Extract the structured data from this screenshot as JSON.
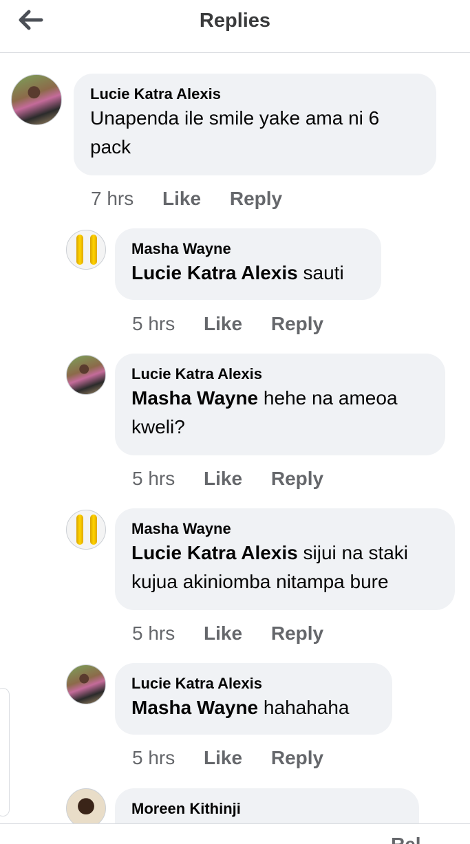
{
  "header": {
    "title": "Replies",
    "back_icon": "arrow-left-icon"
  },
  "comments": [
    {
      "author": "Lucie Katra Alexis",
      "mention": "",
      "text": "Unapenda ile smile yake ama ni 6",
      "text2": "pack",
      "time": "7 hrs",
      "like": "Like",
      "reply": "Reply"
    },
    {
      "author": "Masha Wayne",
      "mention": "Lucie Katra Alexis",
      "text": " sauti",
      "time": "5 hrs",
      "like": "Like",
      "reply": "Reply"
    },
    {
      "author": "Lucie Katra Alexis",
      "mention": "Masha Wayne",
      "text": " hehe na ameoa",
      "text2": "kweli?",
      "time": "5 hrs",
      "like": "Like",
      "reply": "Reply"
    },
    {
      "author": "Masha Wayne",
      "mention": "Lucie Katra Alexis",
      "text": " sijui na staki",
      "text2": "kujua akiniomba nitampa bure",
      "time": "5 hrs",
      "like": "Like",
      "reply": "Reply"
    },
    {
      "author": "Lucie Katra Alexis",
      "mention": "Masha Wayne",
      "text": " hahahaha",
      "time": "5 hrs",
      "like": "Like",
      "reply": "Reply"
    },
    {
      "author": "Moreen Kithinji"
    }
  ],
  "bottom_partial": "Rel"
}
